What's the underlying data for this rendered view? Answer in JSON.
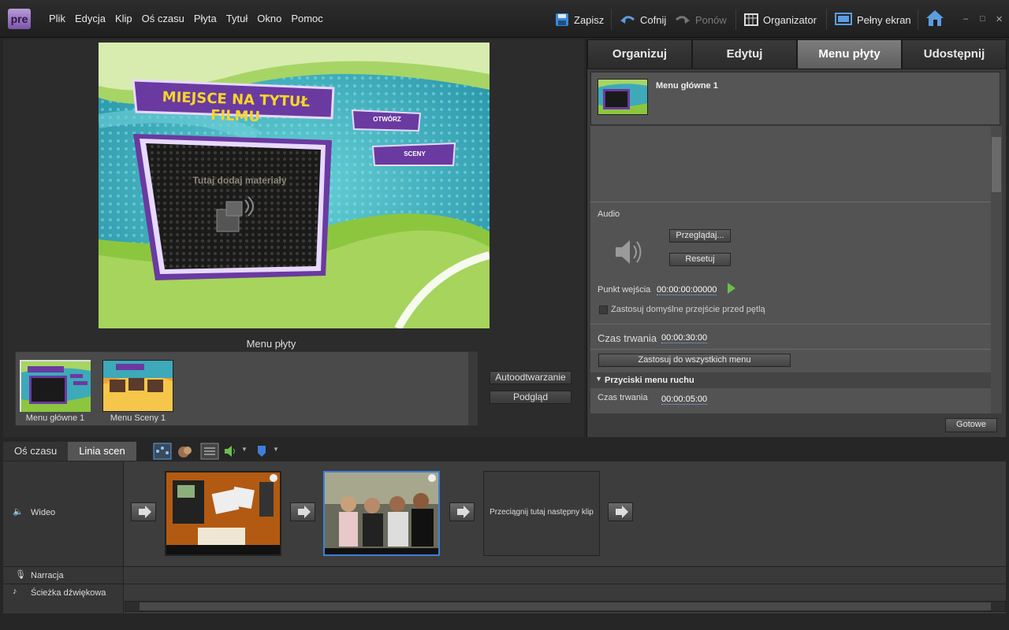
{
  "app": {
    "logo": "pre"
  },
  "menu": [
    "Plik",
    "Edycja",
    "Klip",
    "Oś czasu",
    "Płyta",
    "Tytuł",
    "Okno",
    "Pomoc"
  ],
  "toolbar": {
    "save": "Zapisz",
    "undo": "Cofnij",
    "redo": "Ponów",
    "organizer": "Organizator",
    "fullscreen": "Pełny ekran"
  },
  "preview": {
    "title_placeholder": "MIEJSCE NA TYTUŁ FILMU",
    "play_button": "OTWÓRZ",
    "scenes_button": "SCENY",
    "drop_text": "Tutaj dodaj materiały"
  },
  "disc_menus": {
    "label": "Menu płyty",
    "items": [
      {
        "caption": "Menu główne 1"
      },
      {
        "caption": "Menu Sceny 1"
      }
    ],
    "autoplay_button": "Autoodtwarzanie",
    "preview_button": "Podgląd"
  },
  "right_panel": {
    "tabs": [
      "Organizuj",
      "Edytuj",
      "Menu płyty",
      "Udostępnij"
    ],
    "active_tab": 2,
    "menu_name": "Menu główne 1",
    "audio_label": "Audio",
    "browse_button": "Przeglądaj...",
    "reset_button": "Resetuj",
    "in_point_label": "Punkt wejścia",
    "in_point_value": "00:00:00:00000",
    "transition_checkbox": "Zastosuj domyślne przejście przed pętlą",
    "duration_label": "Czas trwania",
    "duration_value": "00:00:30:00",
    "apply_all_button": "Zastosuj do wszystkich menu",
    "motion_section": "Przyciski menu ruchu",
    "motion_duration_label": "Czas trwania",
    "motion_duration_value": "00:00:05:00",
    "done_button": "Gotowe"
  },
  "timeline": {
    "tabs": [
      "Oś czasu",
      "Linia scen"
    ],
    "active_tab": 1,
    "tracks": {
      "video": "Wideo",
      "narration": "Narracja",
      "soundtrack": "Ścieżka dźwiękowa"
    },
    "drop_target": "Przeciągnij tutaj następny klip"
  },
  "colors": {
    "accent_purple": "#6a3aa0",
    "title_yellow": "#f6d52a",
    "selection_blue": "#3f7fd8"
  }
}
